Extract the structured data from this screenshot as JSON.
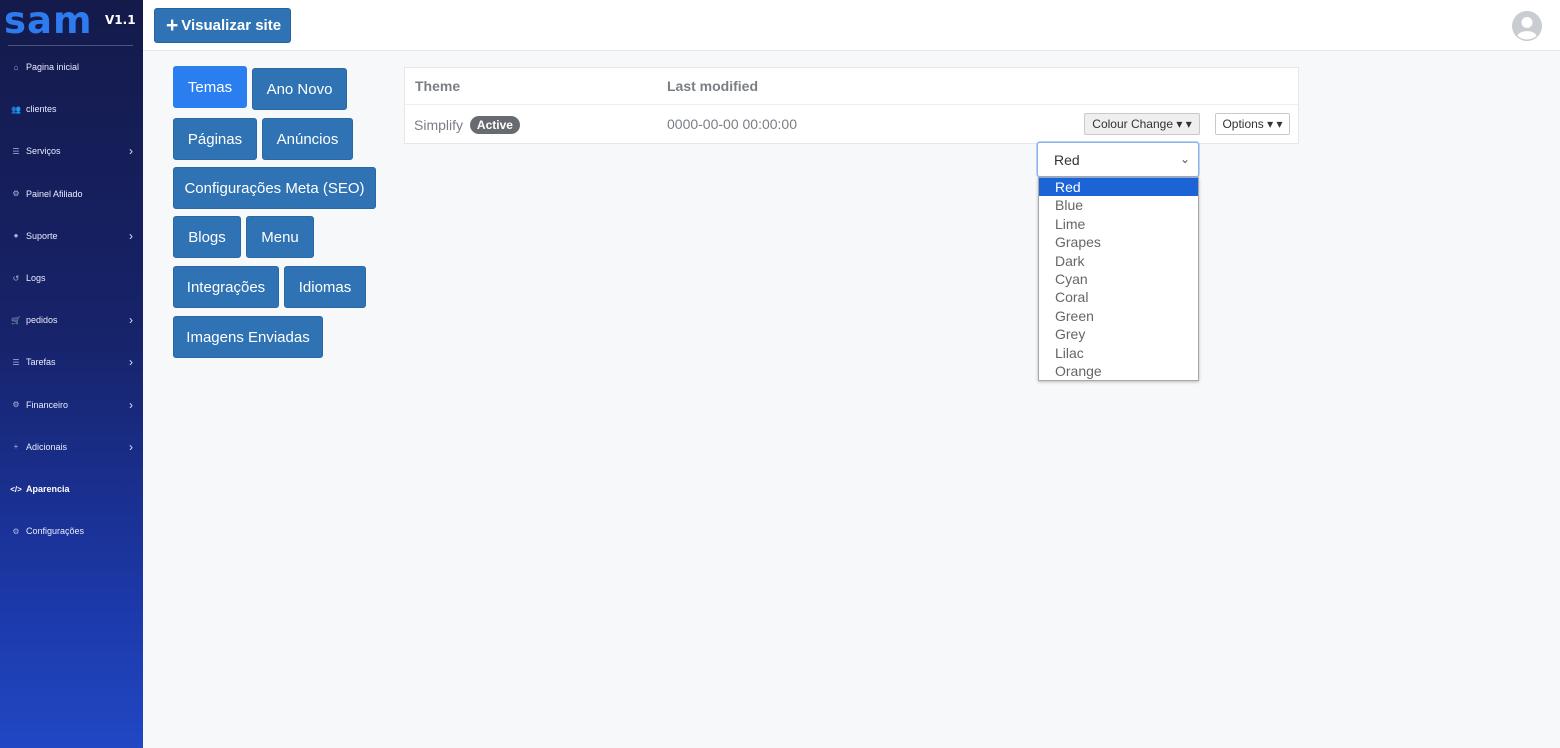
{
  "brand": {
    "logo": "sam",
    "version": "V1.1"
  },
  "sidebar": {
    "items": [
      {
        "label": "Pagina inicial",
        "icon": "home-icon",
        "glyph": "⌂",
        "chevron": false
      },
      {
        "label": "clientes",
        "icon": "users-icon",
        "glyph": "👥",
        "chevron": false
      },
      {
        "label": "Serviços",
        "icon": "list-icon",
        "glyph": "☰",
        "chevron": true
      },
      {
        "label": "Painel Afiliado",
        "icon": "gear-icon",
        "glyph": "⚙",
        "chevron": false
      },
      {
        "label": "Suporte",
        "icon": "chat-icon",
        "glyph": "●",
        "chevron": true
      },
      {
        "label": "Logs",
        "icon": "history-icon",
        "glyph": "↺",
        "chevron": false
      },
      {
        "label": "pedidos",
        "icon": "cart-icon",
        "glyph": "🛒",
        "chevron": true
      },
      {
        "label": "Tarefas",
        "icon": "list-icon",
        "glyph": "☰",
        "chevron": true
      },
      {
        "label": "Financeiro",
        "icon": "gear-icon",
        "glyph": "⚙",
        "chevron": true
      },
      {
        "label": "Adicionais",
        "icon": "plus-icon",
        "glyph": "+",
        "chevron": true
      },
      {
        "label": "Aparencia",
        "icon": "code-icon",
        "glyph": "</>",
        "chevron": false,
        "active": true
      },
      {
        "label": "Configurações",
        "icon": "gear-icon",
        "glyph": "⚙",
        "chevron": false
      }
    ],
    "chevron_glyph": "›"
  },
  "topbar": {
    "visit_button": {
      "plus": "+",
      "label": "Visualizar site"
    }
  },
  "appearance_menu": {
    "buttons": [
      {
        "label": "Temas",
        "current": true
      },
      {
        "label": "Ano Novo"
      },
      {
        "label": "Páginas"
      },
      {
        "label": "Anúncios"
      },
      {
        "label": "Configurações Meta (SEO)"
      },
      {
        "label": "Blogs"
      },
      {
        "label": "Menu"
      },
      {
        "label": "Integrações"
      },
      {
        "label": "Idiomas"
      },
      {
        "label": "Imagens Enviadas"
      }
    ]
  },
  "themes_table": {
    "headers": {
      "theme": "Theme",
      "last_modified": "Last modified"
    },
    "row": {
      "name": "Simplify",
      "badge": "Active",
      "modified": "0000-00-00 00:00:00",
      "colour_change_label": "Colour Change ▾ ▾",
      "options_label": "Options ▾ ▾"
    }
  },
  "colour_select": {
    "value": "Red",
    "arrow": "⌄",
    "options": [
      "Red",
      "Blue",
      "Lime",
      "Grapes",
      "Dark",
      "Cyan",
      "Coral",
      "Green",
      "Grey",
      "Lilac",
      "Orange"
    ],
    "selected_index": 0
  },
  "colors": {
    "accent": "#2f73b4",
    "current_tab": "#2b7ef0",
    "selected_option": "#1a64d6"
  }
}
